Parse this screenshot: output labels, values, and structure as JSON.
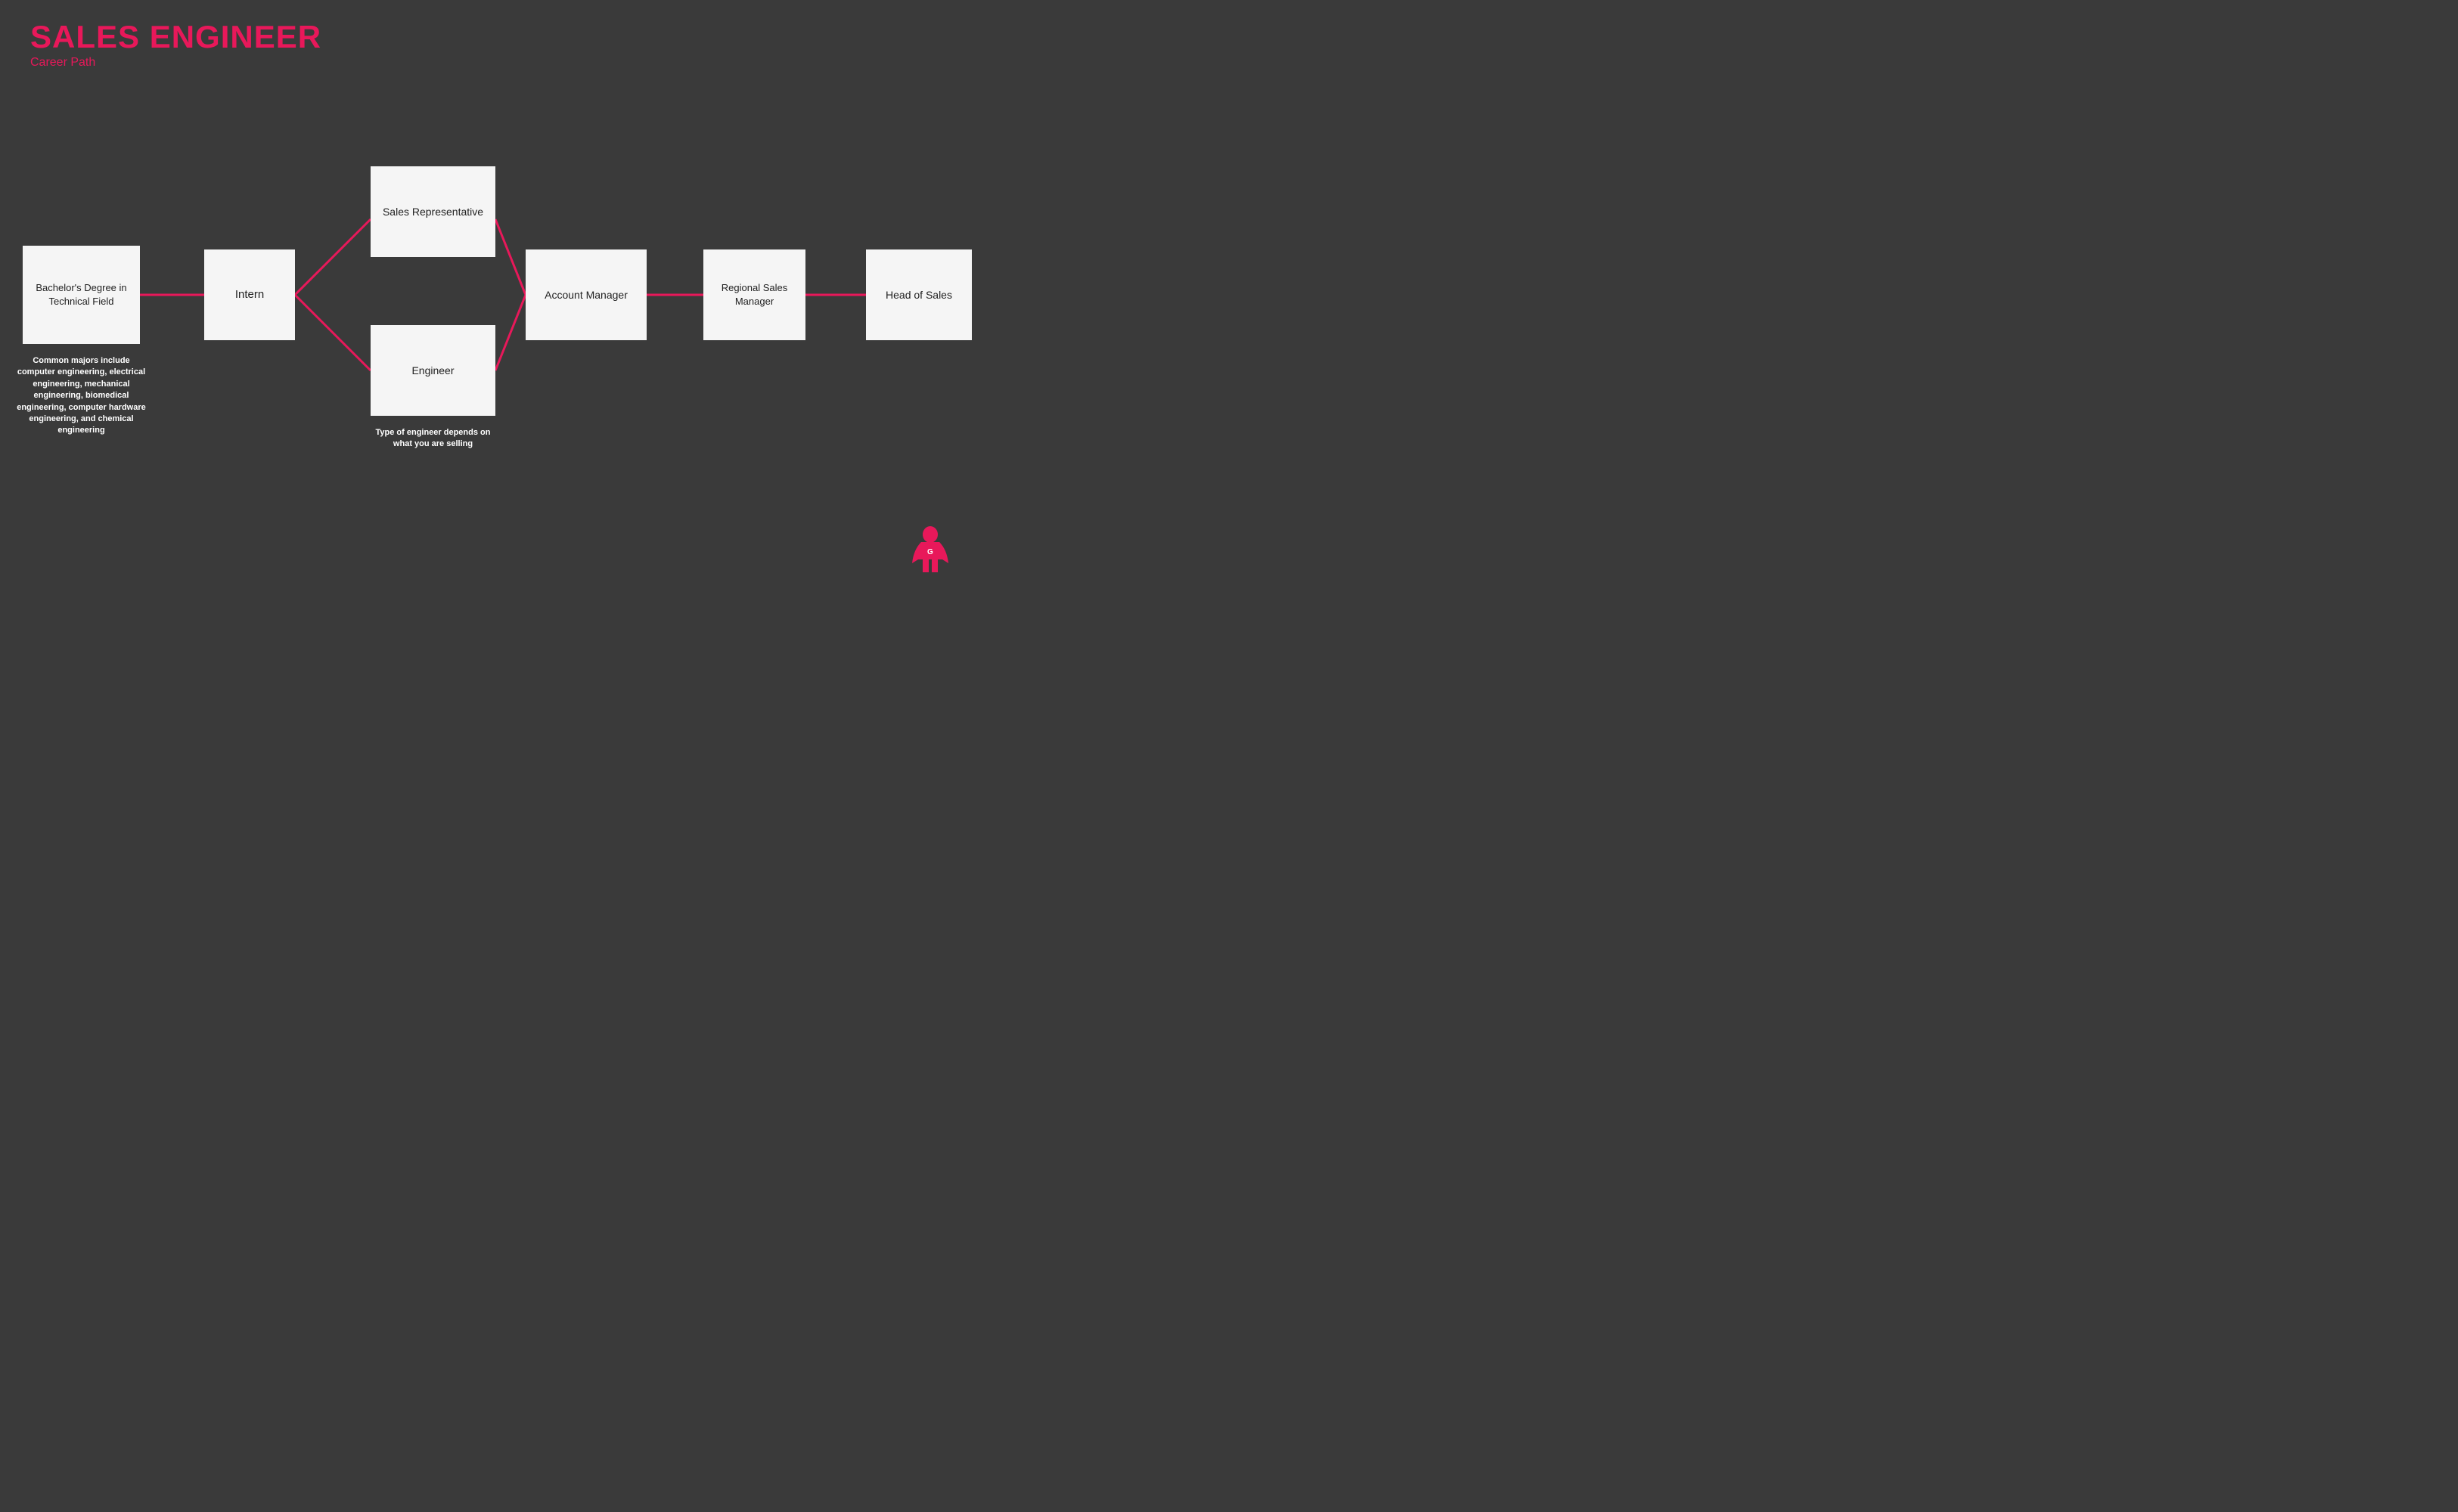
{
  "header": {
    "title": "SALES ENGINEER",
    "subtitle": "Career Path"
  },
  "nodes": {
    "bachelor": {
      "label": "Bachelor's Degree in Technical Field",
      "note": "Common majors include computer engineering, electrical engineering, mechanical engineering, biomedical engineering, computer hardware engineering, and chemical engineering"
    },
    "intern": {
      "label": "Intern"
    },
    "salesRep": {
      "label": "Sales Representative"
    },
    "engineer": {
      "label": "Engineer"
    },
    "engineerNote": {
      "label": "Type of engineer depends on what you are selling"
    },
    "accountManager": {
      "label": "Account Manager"
    },
    "regionalSales": {
      "label": "Regional Sales Manager"
    },
    "headOfSales": {
      "label": "Head of Sales"
    }
  },
  "colors": {
    "pink": "#e8185a",
    "bg": "#3a3a3a",
    "nodeBackground": "#f5f5f5",
    "textDark": "#222222",
    "textLight": "#ffffff"
  }
}
